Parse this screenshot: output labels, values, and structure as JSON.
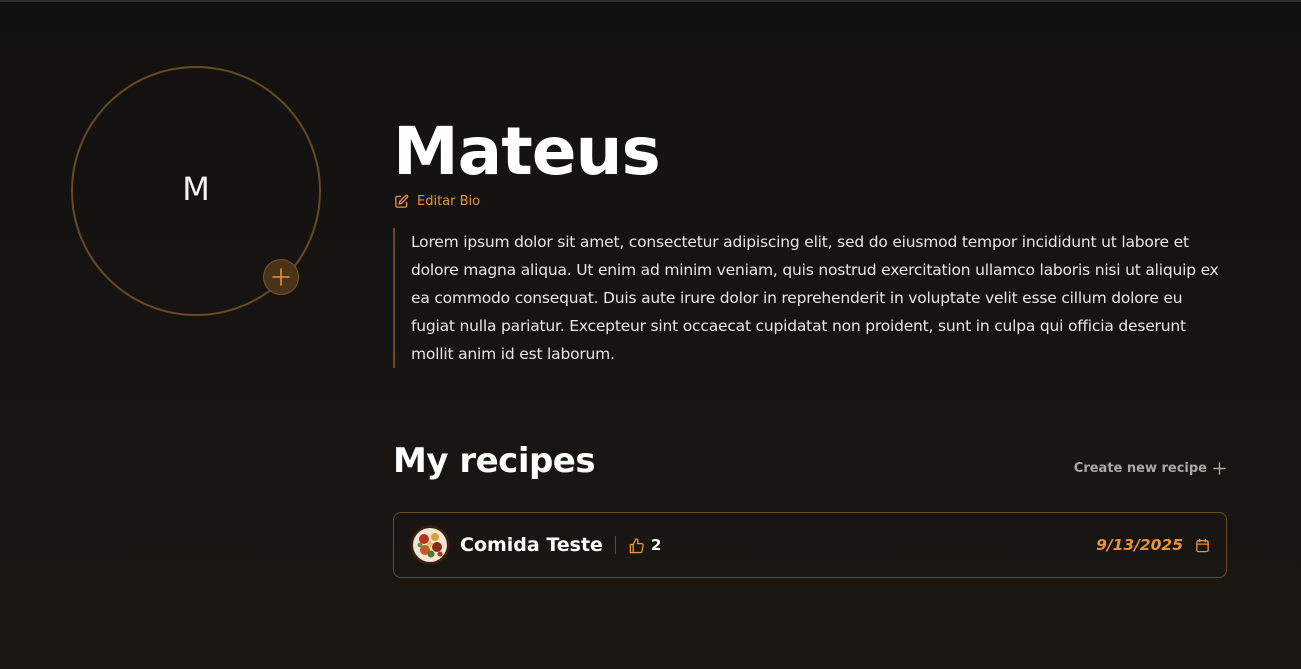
{
  "profile": {
    "initial": "M",
    "name": "Mateus",
    "edit_bio_label": "Editar Bio",
    "bio": "Lorem ipsum dolor sit amet, consectetur adipiscing elit, sed do eiusmod tempor incididunt ut labore et dolore magna aliqua. Ut enim ad minim veniam, quis nostrud exercitation ullamco laboris nisi ut aliquip ex ea commodo consequat. Duis aute irure dolor in reprehenderit in voluptate velit esse cillum dolore eu fugiat nulla pariatur. Excepteur sint occaecat cupidatat non proident, sunt in culpa qui officia deserunt mollit anim id est laborum."
  },
  "recipes_section": {
    "title": "My recipes",
    "create_label": "Create new recipe",
    "items": [
      {
        "name": "Comida Teste",
        "likes": "2",
        "date": "9/13/2025"
      }
    ]
  },
  "colors": {
    "accent": "#e8923a",
    "border": "#6a4a22",
    "background": "#121111"
  },
  "icons": [
    "plus-icon",
    "pencil-square-icon",
    "thumbs-up-icon",
    "calendar-icon"
  ]
}
